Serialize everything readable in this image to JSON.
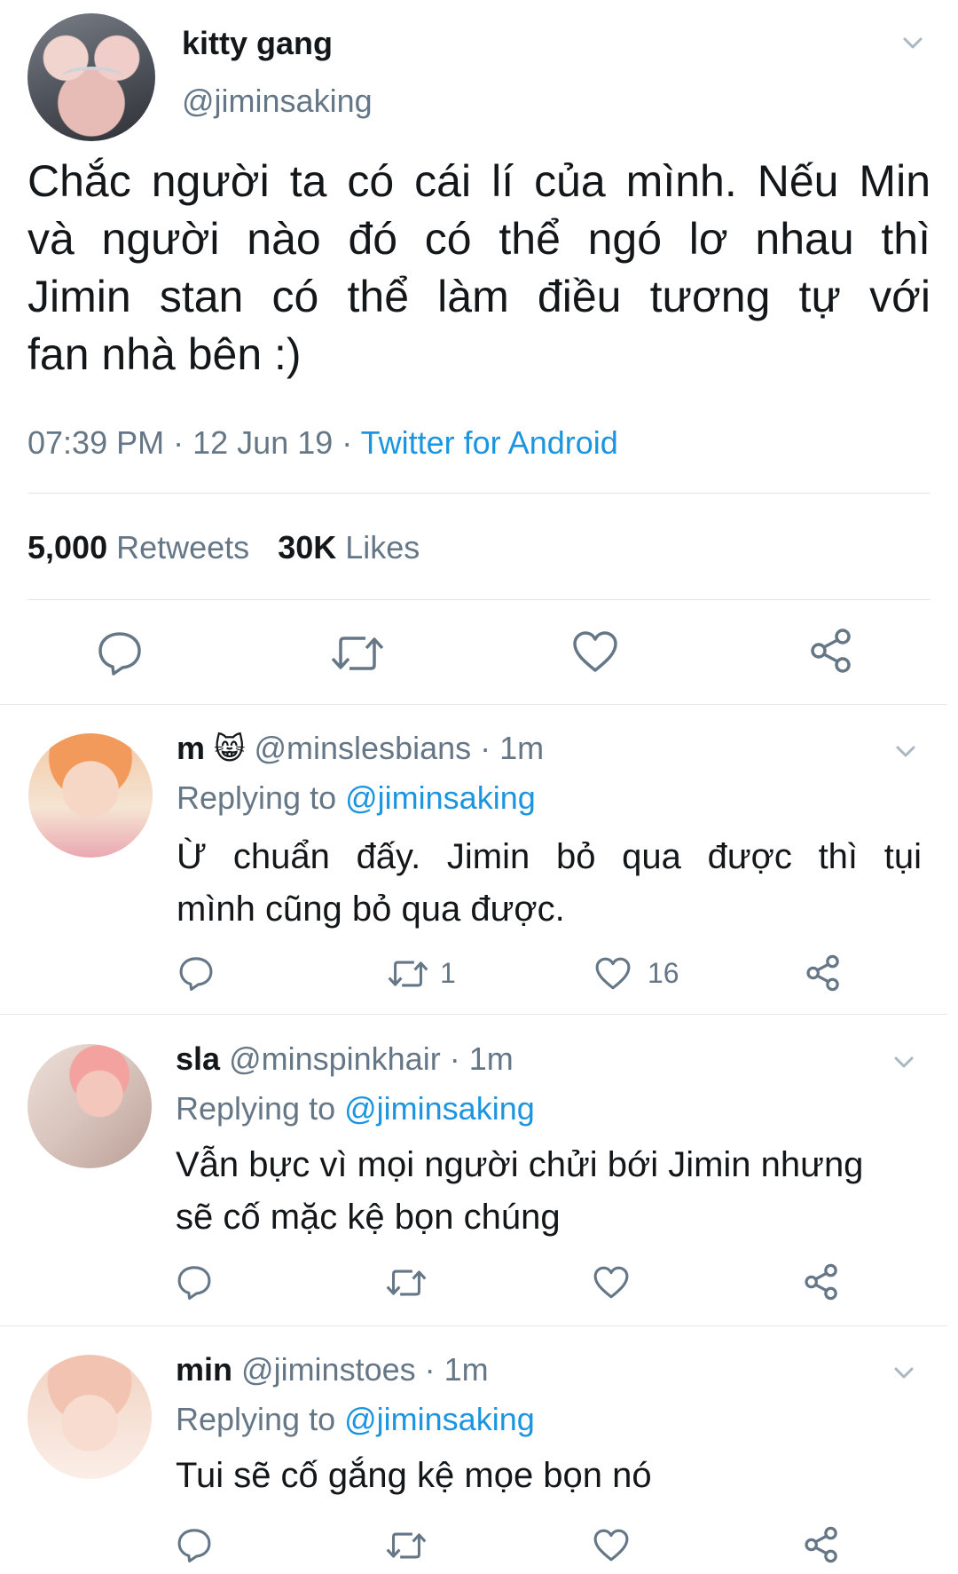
{
  "main_tweet": {
    "display_name": "kitty gang",
    "handle": "@jiminsaking",
    "text_lines": [
      "Chắc người ta có cái lí của mình. Nếu Min",
      "và người nào đó có thể ngó lơ nhau thì",
      "Jimin stan có thể làm điều tương tự với",
      "fan nhà bên :)"
    ],
    "time": "07:39 PM",
    "date": "12 Jun 19",
    "separator": "·",
    "source": "Twitter for Android",
    "retweets_count": "5,000",
    "retweets_label": "Retweets",
    "likes_count": "30K",
    "likes_label": "Likes",
    "avatar_icon": "avatar-hands-over-face"
  },
  "replies": [
    {
      "display_name": "m",
      "emoji": "😸",
      "handle": "@minslesbians",
      "time": "· 1m",
      "replying_label": "Replying to",
      "replying_to": "@jiminsaking",
      "text_lines": [
        "Ừ chuẩn đấy. Jimin bỏ qua được thì tụi",
        "mình cũng bỏ qua được."
      ],
      "retweet_count": "1",
      "like_count": "16"
    },
    {
      "display_name": "sla",
      "handle": "@minspinkhair",
      "time": "· 1m",
      "replying_label": "Replying to",
      "replying_to": "@jiminsaking",
      "text_lines": [
        "Vẫn bực vì mọi người chửi bới Jimin nhưng",
        "sẽ cố mặc kệ bọn chúng"
      ],
      "retweet_count": "",
      "like_count": ""
    },
    {
      "display_name": "min",
      "handle": "@jiminstoes",
      "time": "· 1m",
      "replying_label": "Replying to",
      "replying_to": "@jiminsaking",
      "text_lines": [
        "Tui sẽ cố gắng kệ mọe bọn nó"
      ],
      "retweet_count": "",
      "like_count": ""
    }
  ],
  "colors": {
    "link_blue": "#1b95e0",
    "muted_gray": "#657786",
    "icon_gray": "#657786",
    "divider": "#e1e8ed"
  }
}
